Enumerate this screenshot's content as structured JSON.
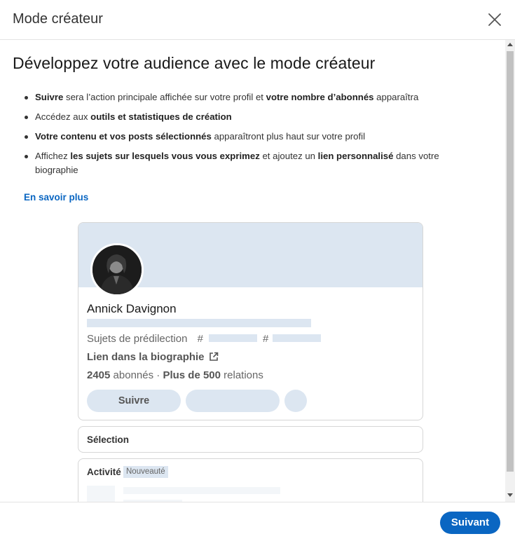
{
  "dialog": {
    "title": "Mode créateur",
    "close_icon": "close-icon"
  },
  "main": {
    "headline": "Développez votre audience avec le mode créateur",
    "bullets": [
      {
        "b1": "Suivre",
        "t1": " sera l’action principale affichée sur votre profil et ",
        "b2": "votre nombre d’abonnés",
        "t2": " apparaîtra"
      },
      {
        "t1": "Accédez aux ",
        "b1": "outils et statistiques de création"
      },
      {
        "b1": "Votre contenu et vos posts sélectionnés",
        "t1": " apparaîtront plus haut sur votre profil"
      },
      {
        "t1": "Affichez ",
        "b1": "les sujets sur lesquels vous vous exprimez",
        "t2": " et ajoutez un ",
        "b2": "lien personnalisé",
        "t3": " dans votre biographie"
      }
    ],
    "learn_more": "En savoir plus"
  },
  "profile_preview": {
    "name": "Annick Davignon",
    "topics_label": "Sujets de prédilection",
    "hash": "#",
    "bio_link": "Lien dans la biographie",
    "followers_count": "2405",
    "followers_label": " abonnés · ",
    "connections_bold": "Plus de 500",
    "connections_label": " relations",
    "follow_button": "Suivre",
    "link_icon": "external-link-icon"
  },
  "sections": {
    "selection_label": "Sélection",
    "activity_label": "Activité",
    "new_badge": "Nouveauté"
  },
  "footer": {
    "next_button": "Suivant"
  },
  "colors": {
    "primary": "#0a66c2",
    "placeholder": "#dce6f1"
  }
}
